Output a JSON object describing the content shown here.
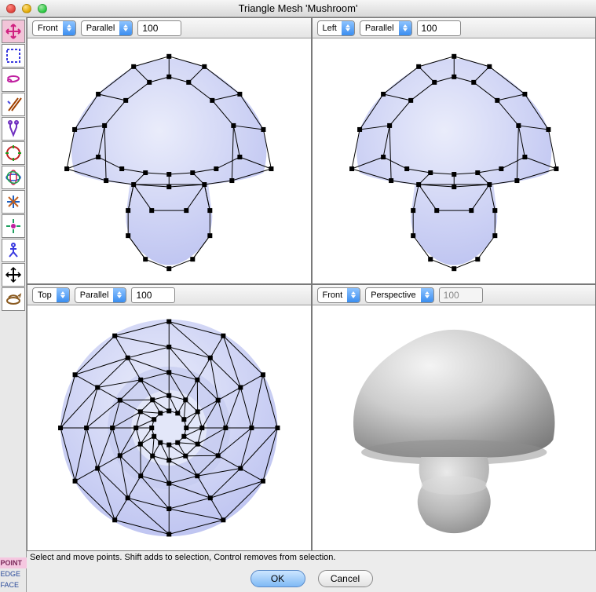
{
  "window": {
    "title": "Triangle Mesh 'Mushroom'"
  },
  "tools": [
    {
      "name": "move-tool",
      "selected": true
    },
    {
      "name": "select-region-tool"
    },
    {
      "name": "lasso-tool"
    },
    {
      "name": "tweak-tool"
    },
    {
      "name": "bone-tool"
    },
    {
      "name": "rotate-tool"
    },
    {
      "name": "orbit-tool"
    },
    {
      "name": "snap-tool"
    },
    {
      "name": "vertex-tool"
    },
    {
      "name": "skeleton-tool"
    },
    {
      "name": "crosshair-tool"
    },
    {
      "name": "view-angle-tool"
    }
  ],
  "selmodes": {
    "point": "POINT",
    "edge": "EDGE",
    "face": "FACE",
    "active": "point"
  },
  "viewports": {
    "tl": {
      "camera": "Front",
      "projection": "Parallel",
      "zoom": "100"
    },
    "tr": {
      "camera": "Left",
      "projection": "Parallel",
      "zoom": "100"
    },
    "bl": {
      "camera": "Top",
      "projection": "Parallel",
      "zoom": "100"
    },
    "br": {
      "camera": "Front",
      "projection": "Perspective",
      "zoom": "100",
      "zoom_disabled": true
    }
  },
  "status": "Select and move points.  Shift adds to selection, Control removes from selection.",
  "buttons": {
    "ok": "OK",
    "cancel": "Cancel"
  }
}
